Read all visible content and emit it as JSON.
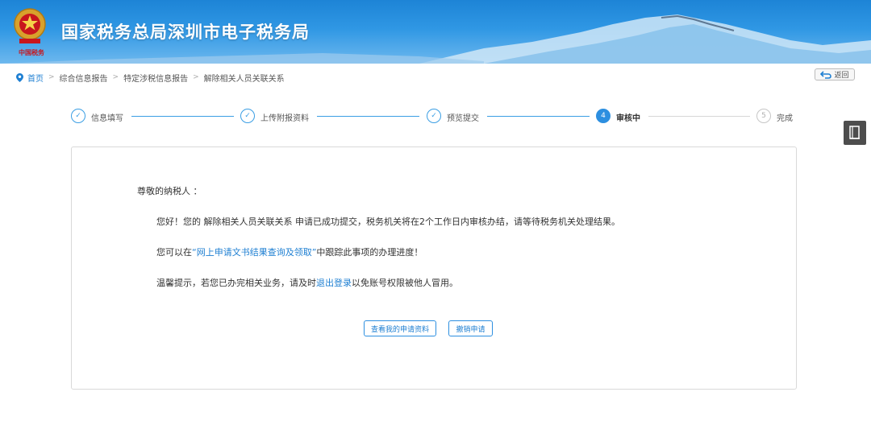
{
  "header": {
    "title": "国家税务总局深圳市电子税务局",
    "emblem_caption": "中国税务"
  },
  "breadcrumb": {
    "items": [
      "首页",
      "综合信息报告",
      "特定涉税信息报告",
      "解除相关人员关联关系"
    ],
    "separator": ">"
  },
  "back_button": {
    "label": "返回"
  },
  "stepper": {
    "steps": [
      {
        "label": "信息填写",
        "state": "done",
        "marker": "✓"
      },
      {
        "label": "上传附报资料",
        "state": "done",
        "marker": "✓"
      },
      {
        "label": "预览提交",
        "state": "done",
        "marker": "✓"
      },
      {
        "label": "审核中",
        "state": "active",
        "marker": "4"
      },
      {
        "label": "完成",
        "state": "todo",
        "marker": "5"
      }
    ]
  },
  "message": {
    "greeting": "尊敬的纳税人 ：",
    "p1": "您好！您的 解除相关人员关联关系 申请已成功提交，税务机关将在2个工作日内审核办结，请等待税务机关处理结果。",
    "p2_prefix": "您可以在",
    "p2_link": "“网上申请文书结果查询及领取”",
    "p2_suffix": "中跟踪此事项的办理进度！",
    "p3_prefix": "温馨提示，若您已办完相关业务，请及时",
    "p3_link": "退出登录",
    "p3_suffix": "以免账号权限被他人冒用。"
  },
  "actions": {
    "view_label": "查看我的申请资料",
    "cancel_label": "撤销申请"
  },
  "colors": {
    "accent": "#2d8fe0",
    "link": "#1e7fd2",
    "header_top": "#1d84d6"
  }
}
